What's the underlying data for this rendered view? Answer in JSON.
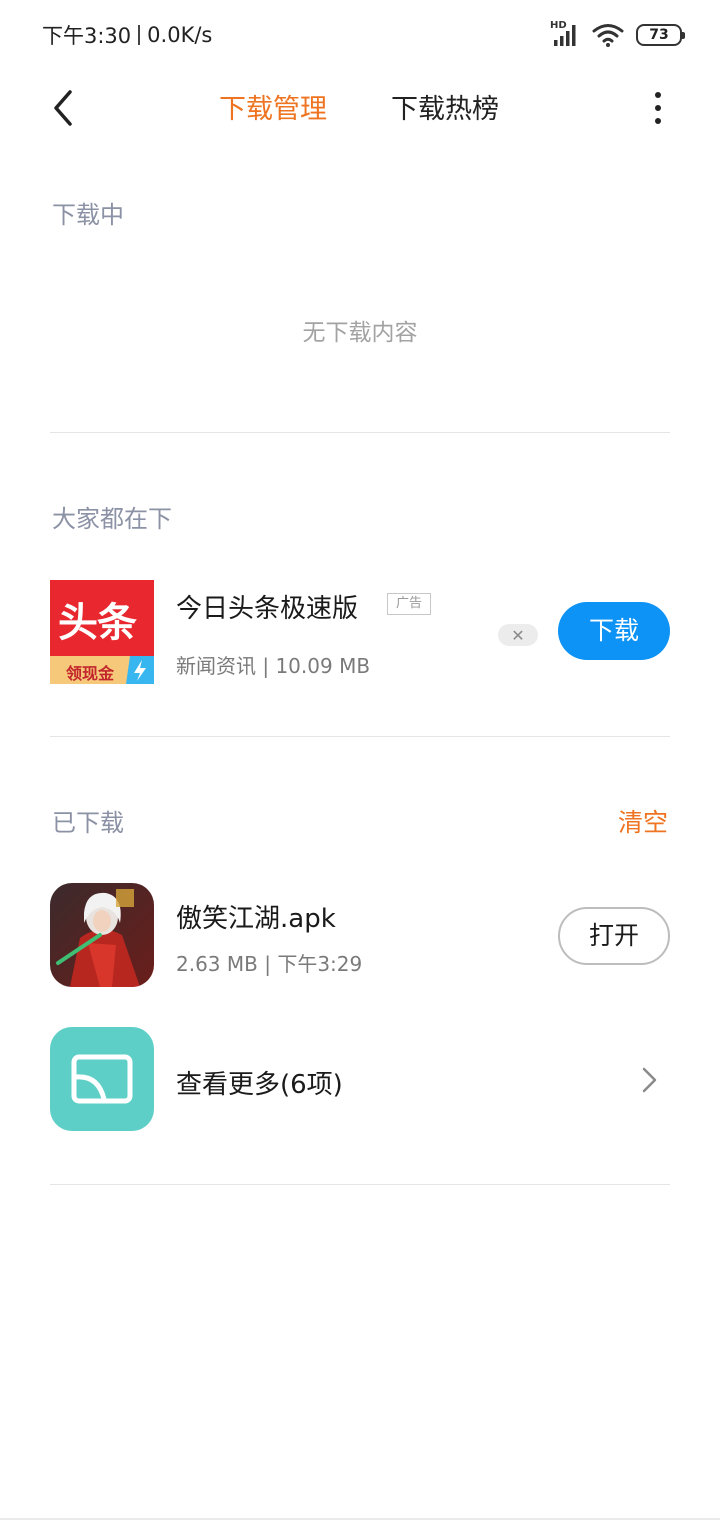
{
  "status_bar": {
    "time": "下午3:30",
    "speed": "0.0K/s",
    "network": "HD",
    "battery": "73",
    "icons": [
      "signal-icon",
      "wifi-icon",
      "battery-icon"
    ]
  },
  "nav": {
    "back_icon": "back-chevron-icon",
    "tabs": [
      {
        "label": "下载管理",
        "active": true
      },
      {
        "label": "下载热榜",
        "active": false
      }
    ],
    "more_icon": "more-vertical-icon"
  },
  "downloading": {
    "title": "下载中",
    "empty_text": "无下载内容"
  },
  "recommended": {
    "title": "大家都在下",
    "app": {
      "name": "今日头条极速版",
      "ad_label": "广告",
      "meta": "新闻资讯 | 10.09 MB",
      "icon_text_top": "头条",
      "icon_text_bottom": "领现金",
      "button": "下载",
      "dismiss_icon": "close-icon"
    }
  },
  "downloaded": {
    "title": "已下载",
    "clear": "清空",
    "item": {
      "name": "傲笑江湖.apk",
      "meta": "2.63 MB | 下午3:29",
      "button": "打开"
    },
    "more": {
      "label": "查看更多(6项)",
      "icon": "image-folder-icon"
    }
  },
  "colors": {
    "accent": "#ef7422",
    "primary_button": "#0d93f5",
    "section_title": "#8c92a6",
    "more_icon_bg": "#5dcfc7"
  }
}
